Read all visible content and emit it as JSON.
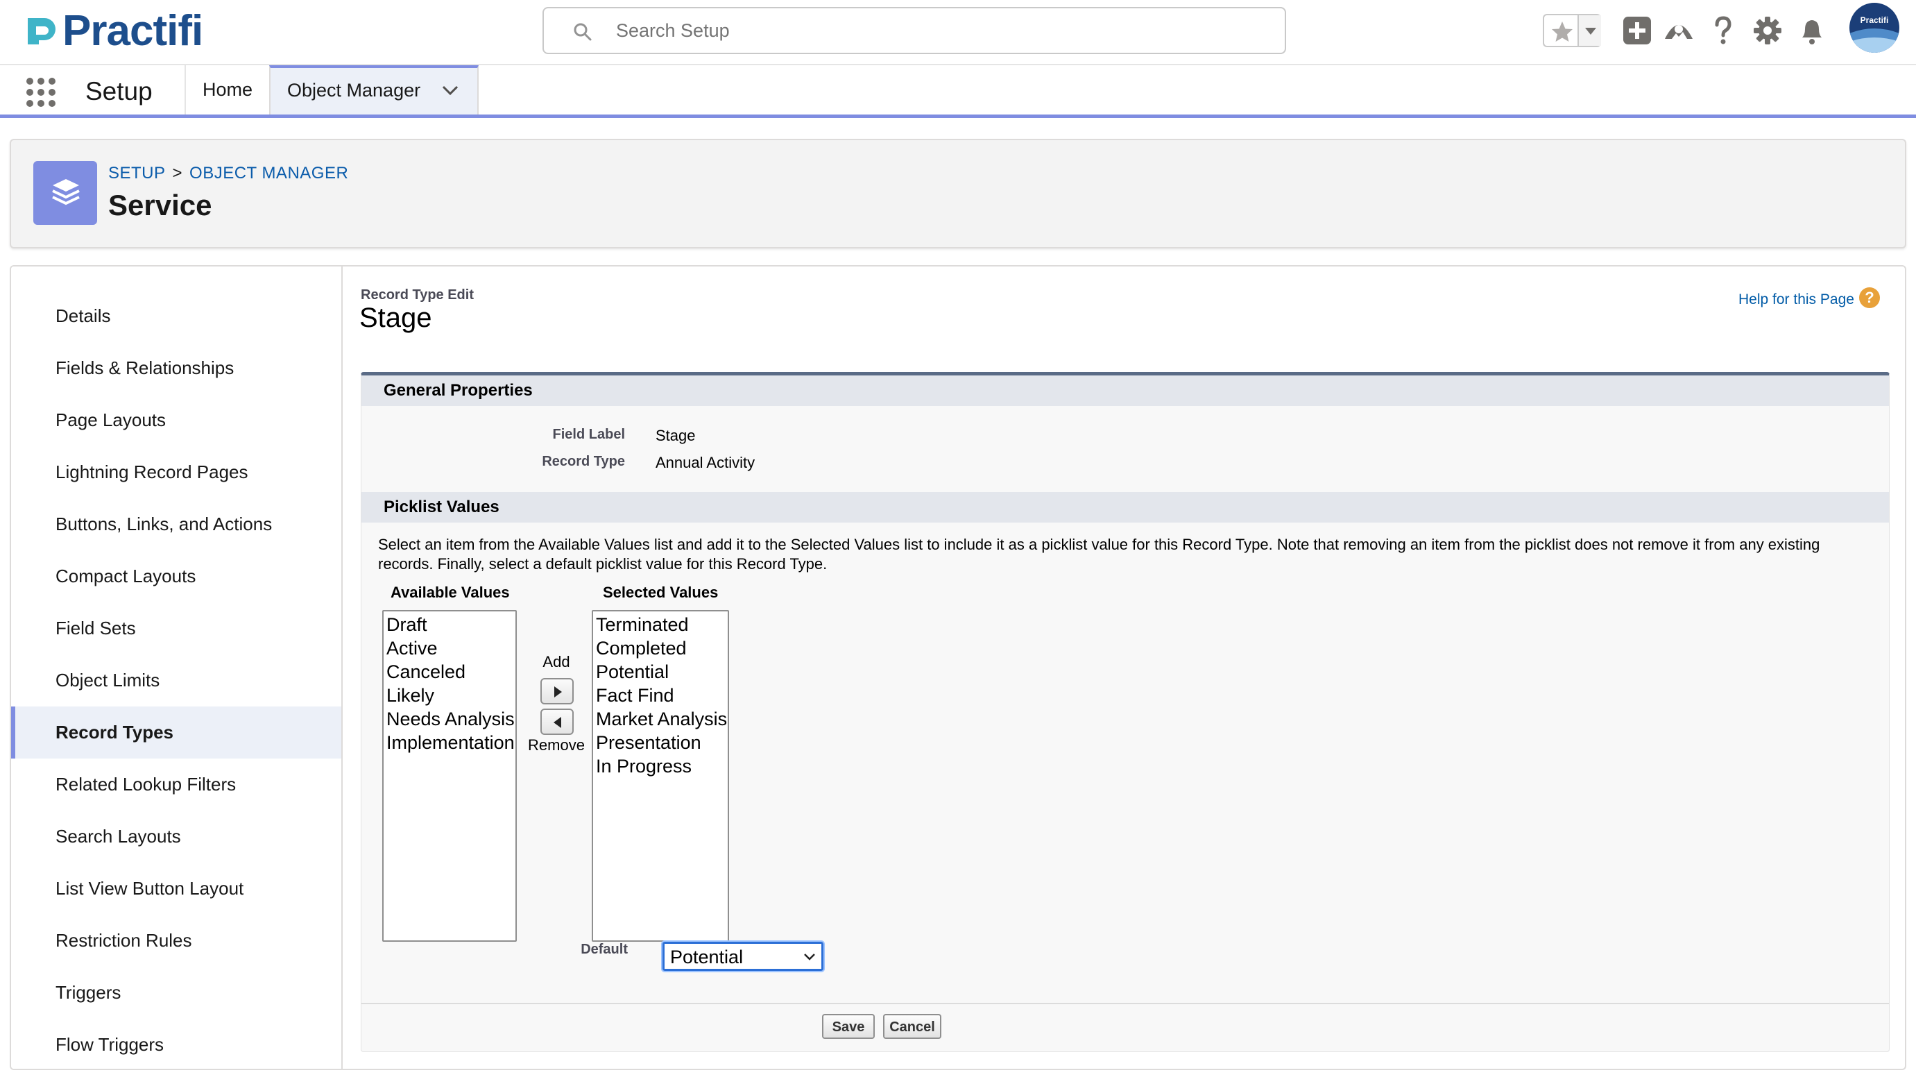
{
  "header": {
    "logo_text": "Practifi",
    "search_placeholder": "Search Setup",
    "avatar_label": "Practifi"
  },
  "nav": {
    "app_name": "Setup",
    "tabs": [
      {
        "label": "Home"
      },
      {
        "label": "Object Manager",
        "active": true
      }
    ]
  },
  "page_header": {
    "breadcrumb": [
      "SETUP",
      ">",
      "OBJECT MANAGER"
    ],
    "title": "Service"
  },
  "sidebar": {
    "items": [
      {
        "label": "Details"
      },
      {
        "label": "Fields & Relationships"
      },
      {
        "label": "Page Layouts"
      },
      {
        "label": "Lightning Record Pages"
      },
      {
        "label": "Buttons, Links, and Actions"
      },
      {
        "label": "Compact Layouts"
      },
      {
        "label": "Field Sets"
      },
      {
        "label": "Object Limits"
      },
      {
        "label": "Record Types",
        "active": true
      },
      {
        "label": "Related Lookup Filters"
      },
      {
        "label": "Search Layouts"
      },
      {
        "label": "List View Button Layout"
      },
      {
        "label": "Restriction Rules"
      },
      {
        "label": "Triggers"
      },
      {
        "label": "Flow Triggers"
      }
    ]
  },
  "content": {
    "page_type": "Record Type Edit",
    "page_title": "Stage",
    "help_link": "Help for this Page",
    "help_icon": "?",
    "general": {
      "heading": "General Properties",
      "field_label_label": "Field Label",
      "field_label_value": "Stage",
      "record_type_label": "Record Type",
      "record_type_value": "Annual Activity"
    },
    "picklist": {
      "heading": "Picklist Values",
      "instructions": "Select an item from the Available Values list and add it to the Selected Values list to include it as a picklist value for this Record Type. Note that removing an item from the picklist does not remove it from any existing records. Finally, select a default picklist value for this Record Type.",
      "available_heading": "Available Values",
      "selected_heading": "Selected Values",
      "available": [
        "Draft",
        "Active",
        "Canceled",
        "Likely",
        "Needs Analysis",
        "Implementation"
      ],
      "selected": [
        "Terminated",
        "Completed",
        "Potential",
        "Fact Find",
        "Market Analysis",
        "Presentation",
        "In Progress"
      ],
      "add_label": "Add",
      "remove_label": "Remove",
      "default_label": "Default",
      "default_value": "Potential"
    },
    "buttons": {
      "save": "Save",
      "cancel": "Cancel"
    }
  },
  "colors": {
    "brand": "#1d4e8c",
    "accent": "#7f8de1",
    "link": "#0b5cab",
    "section_bar": "#e3e6ec"
  }
}
